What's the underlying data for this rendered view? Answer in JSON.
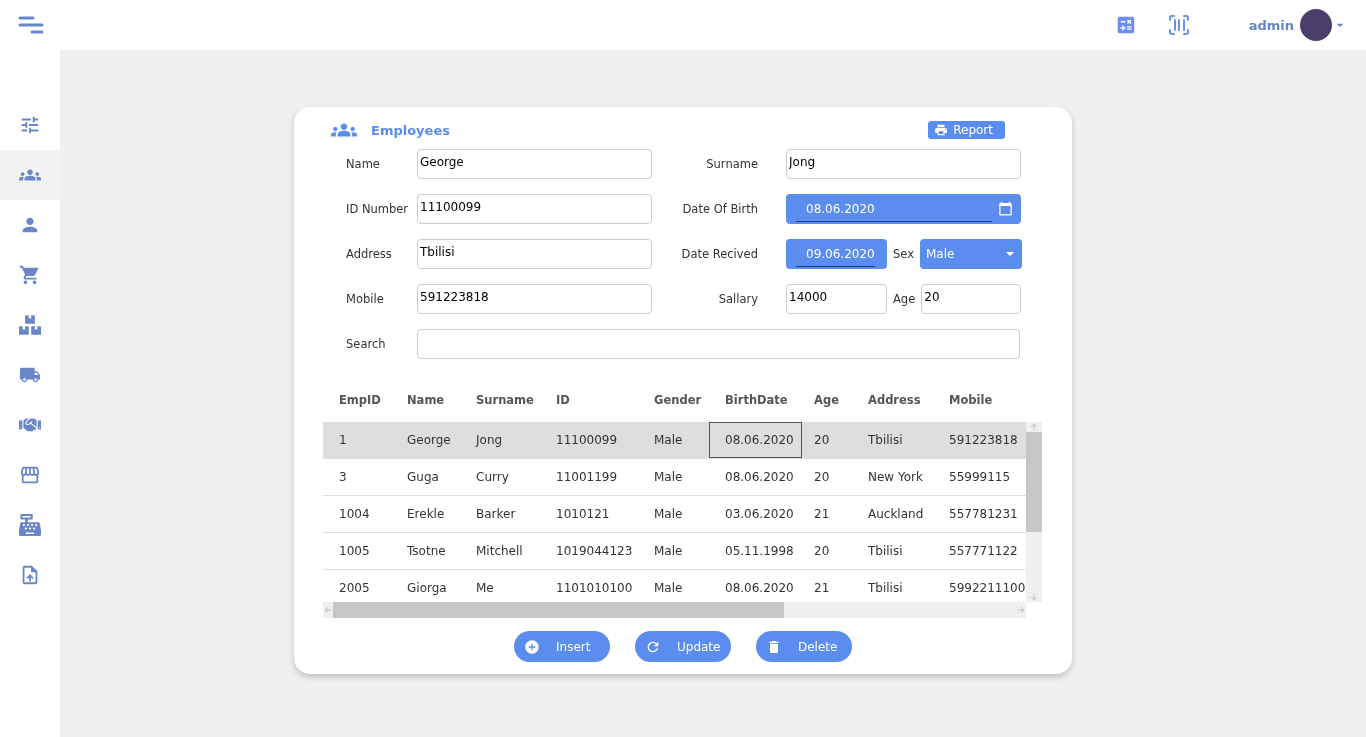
{
  "header": {
    "user": "admin"
  },
  "sidebar": {
    "items": [
      {
        "kind": "sliders",
        "selected": false
      },
      {
        "kind": "group",
        "selected": true
      },
      {
        "kind": "person",
        "selected": false
      },
      {
        "kind": "cart",
        "selected": false
      },
      {
        "kind": "boxes",
        "selected": false
      },
      {
        "kind": "truck",
        "selected": false
      },
      {
        "kind": "handshake",
        "selected": false
      },
      {
        "kind": "store",
        "selected": false
      },
      {
        "kind": "register",
        "selected": false
      },
      {
        "kind": "report",
        "selected": false
      }
    ]
  },
  "card": {
    "title": "Employees",
    "report_button": "Report",
    "form_rows": [
      {
        "fields": [
          {
            "label": "Name",
            "value": "George",
            "kind": "text"
          },
          {
            "label": "Surname",
            "value": "Jong",
            "kind": "text"
          }
        ]
      },
      {
        "fields": [
          {
            "label": "ID Number",
            "value": "11100099",
            "kind": "text"
          },
          {
            "label": "Date Of Birth",
            "value": "08.06.2020",
            "kind": "date"
          }
        ]
      },
      {
        "fields": [
          {
            "label": "Address",
            "value": "Tbilisi",
            "kind": "text"
          },
          {
            "label": "Date Recived",
            "value": "09.06.2020",
            "kind": "date"
          },
          {
            "label": "Sex",
            "value": "Male",
            "kind": "select"
          }
        ]
      },
      {
        "fields": [
          {
            "label": "Mobile",
            "value": "591223818",
            "kind": "text"
          },
          {
            "label": "Sallary",
            "value": "14000",
            "kind": "text"
          },
          {
            "label": "Age",
            "value": "20",
            "kind": "text"
          }
        ]
      },
      {
        "fields": [
          {
            "label": "Search",
            "kind": "text"
          }
        ]
      }
    ],
    "table": {
      "columns": [
        "EmpID",
        "Name",
        "Surname",
        "ID",
        "Gender",
        "BirthDate",
        "Age",
        "Address",
        "Mobile"
      ],
      "rows": [
        {
          "selected": true,
          "cells": [
            "1",
            "George",
            "Jong",
            "11100099",
            "Male",
            "08.06.2020",
            "20",
            "Tbilisi",
            "591223818"
          ]
        },
        {
          "selected": false,
          "cells": [
            "3",
            "Guga",
            "Curry",
            "11001199",
            "Male",
            "08.06.2020",
            "20",
            "New York",
            "55999115"
          ]
        },
        {
          "selected": false,
          "cells": [
            "1004",
            "Erekle",
            "Barker",
            "1010121",
            "Male",
            "03.06.2020",
            "21",
            "Auckland",
            "557781231"
          ]
        },
        {
          "selected": false,
          "cells": [
            "1005",
            "Tsotne",
            "Mitchell",
            "1019044123",
            "Male",
            "05.11.1998",
            "20",
            "Tbilisi",
            "557771122"
          ]
        },
        {
          "selected": false,
          "cells": [
            "2005",
            "Giorga",
            "Me",
            "1101010100",
            "Male",
            "08.06.2020",
            "21",
            "Tbilisi",
            "5992211100"
          ]
        }
      ]
    },
    "buttons": [
      {
        "kind": "insert",
        "label": "Insert"
      },
      {
        "kind": "update",
        "label": "Update"
      },
      {
        "kind": "delete",
        "label": "Delete"
      }
    ]
  }
}
